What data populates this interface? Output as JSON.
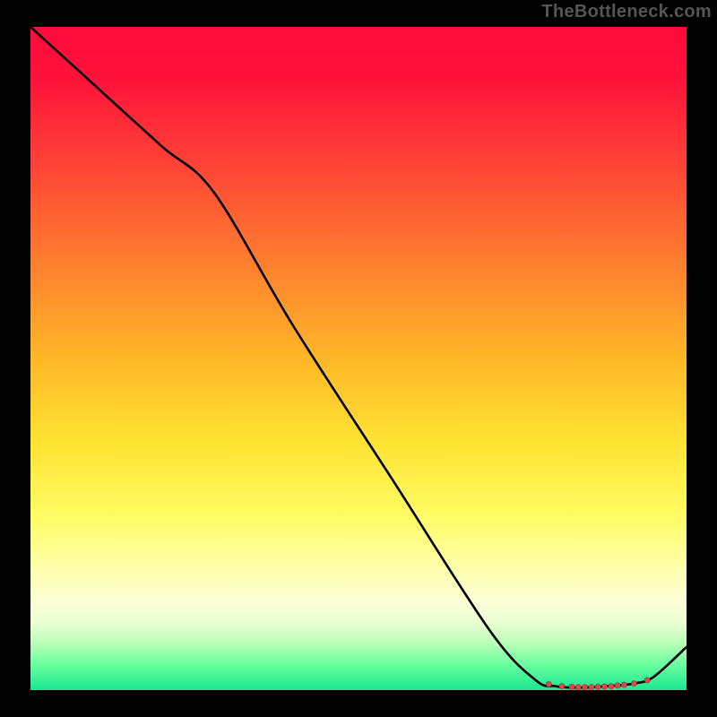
{
  "watermark": "TheBottleneck.com",
  "chart_data": {
    "type": "line",
    "title": "",
    "xlabel": "",
    "ylabel": "",
    "xlim": [
      0,
      100
    ],
    "ylim": [
      0,
      100
    ],
    "grid": false,
    "series": [
      {
        "name": "curve",
        "x": [
          0,
          10,
          20,
          28,
          40,
          55,
          70,
          77,
          80,
          82,
          85,
          88,
          92,
          95,
          100
        ],
        "y": [
          100,
          91,
          82,
          75,
          55,
          32,
          9,
          1.5,
          0.6,
          0.4,
          0.4,
          0.6,
          1.0,
          2.0,
          6.5
        ]
      }
    ],
    "markers": {
      "name": "highlight-dots",
      "x": [
        79,
        81,
        82.5,
        83.5,
        84.5,
        85.5,
        86.5,
        87.5,
        88.5,
        89.5,
        90.5,
        92,
        94
      ],
      "y": [
        0.9,
        0.6,
        0.5,
        0.45,
        0.45,
        0.45,
        0.5,
        0.55,
        0.6,
        0.7,
        0.8,
        1.0,
        1.5
      ]
    },
    "gradient_stops": [
      {
        "pos": 0.0,
        "color": "#ff0a3c"
      },
      {
        "pos": 0.35,
        "color": "#ff7c2f"
      },
      {
        "pos": 0.63,
        "color": "#ffe433"
      },
      {
        "pos": 0.87,
        "color": "#fbffd8"
      },
      {
        "pos": 1.0,
        "color": "#18e890"
      }
    ]
  }
}
